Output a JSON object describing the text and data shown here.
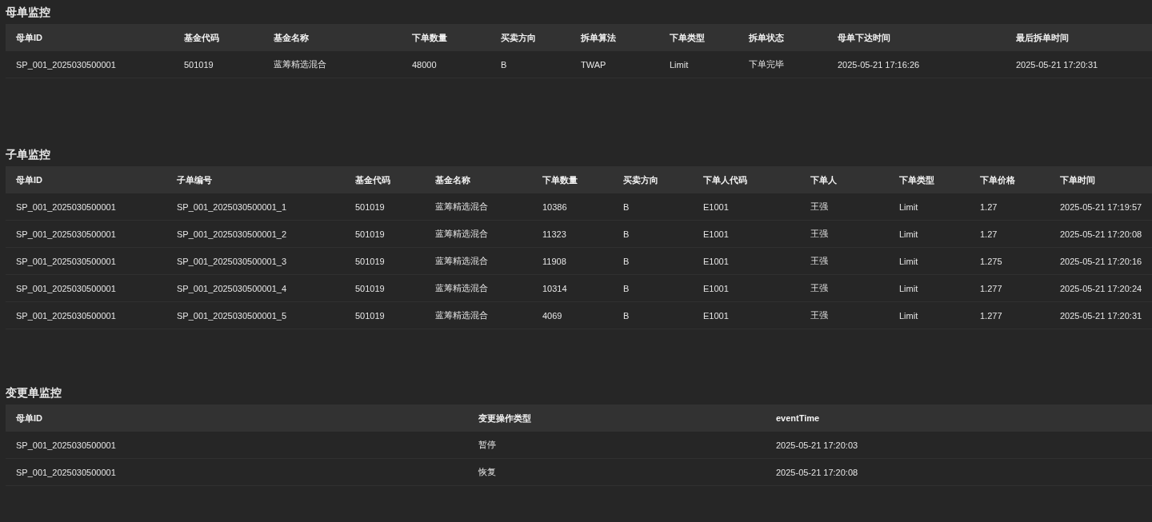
{
  "sections": [
    {
      "title": "母单监控",
      "table": {
        "columns": [
          "母单ID",
          "基金代码",
          "基金名称",
          "下单数量",
          "买卖方向",
          "拆单算法",
          "下单类型",
          "拆单状态",
          "母单下达时间",
          "最后拆单时间"
        ],
        "rows": [
          [
            "SP_001_2025030500001",
            "501019",
            "蓝筹精选混合",
            "48000",
            "B",
            "TWAP",
            "Limit",
            "下单完毕",
            "2025-05-21 17:16:26",
            "2025-05-21 17:20:31"
          ]
        ]
      }
    },
    {
      "title": "子单监控",
      "table": {
        "columns": [
          "母单ID",
          "子单编号",
          "基金代码",
          "基金名称",
          "下单数量",
          "买卖方向",
          "下单人代码",
          "下单人",
          "下单类型",
          "下单价格",
          "下单时间"
        ],
        "rows": [
          [
            "SP_001_2025030500001",
            "SP_001_2025030500001_1",
            "501019",
            "蓝筹精选混合",
            "10386",
            "B",
            "E1001",
            "王强",
            "Limit",
            "1.27",
            "2025-05-21 17:19:57"
          ],
          [
            "SP_001_2025030500001",
            "SP_001_2025030500001_2",
            "501019",
            "蓝筹精选混合",
            "11323",
            "B",
            "E1001",
            "王强",
            "Limit",
            "1.27",
            "2025-05-21 17:20:08"
          ],
          [
            "SP_001_2025030500001",
            "SP_001_2025030500001_3",
            "501019",
            "蓝筹精选混合",
            "11908",
            "B",
            "E1001",
            "王强",
            "Limit",
            "1.275",
            "2025-05-21 17:20:16"
          ],
          [
            "SP_001_2025030500001",
            "SP_001_2025030500001_4",
            "501019",
            "蓝筹精选混合",
            "10314",
            "B",
            "E1001",
            "王强",
            "Limit",
            "1.277",
            "2025-05-21 17:20:24"
          ],
          [
            "SP_001_2025030500001",
            "SP_001_2025030500001_5",
            "501019",
            "蓝筹精选混合",
            "4069",
            "B",
            "E1001",
            "王强",
            "Limit",
            "1.277",
            "2025-05-21 17:20:31"
          ]
        ]
      }
    },
    {
      "title": "变更单监控",
      "table": {
        "columns": [
          "母单ID",
          "变更操作类型",
          "eventTime"
        ],
        "rows": [
          [
            "SP_001_2025030500001",
            "暂停",
            "2025-05-21 17:20:03"
          ],
          [
            "SP_001_2025030500001",
            "恢复",
            "2025-05-21 17:20:08"
          ]
        ]
      }
    }
  ]
}
